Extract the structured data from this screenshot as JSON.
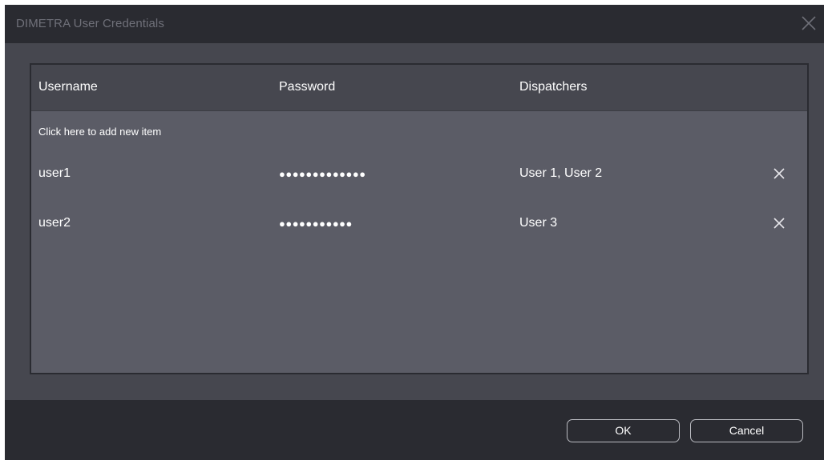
{
  "window": {
    "title": "DIMETRA User Credentials"
  },
  "grid": {
    "columns": [
      "Username",
      "Password",
      "Dispatchers"
    ],
    "add_new_label": "Click here to add new item",
    "rows": [
      {
        "username": "user1",
        "password": "●●●●●●●●●●●●●",
        "dispatchers": "User 1, User 2"
      },
      {
        "username": "user2",
        "password": "●●●●●●●●●●●",
        "dispatchers": "User 3"
      }
    ]
  },
  "buttons": {
    "ok": "OK",
    "cancel": "Cancel"
  },
  "icons": {
    "close": "close-icon",
    "delete": "delete-x-icon"
  },
  "colors": {
    "titlebar": "#2a2b31",
    "body": "#46474f",
    "grid": "#5b5c66",
    "text": "#ffffff"
  }
}
